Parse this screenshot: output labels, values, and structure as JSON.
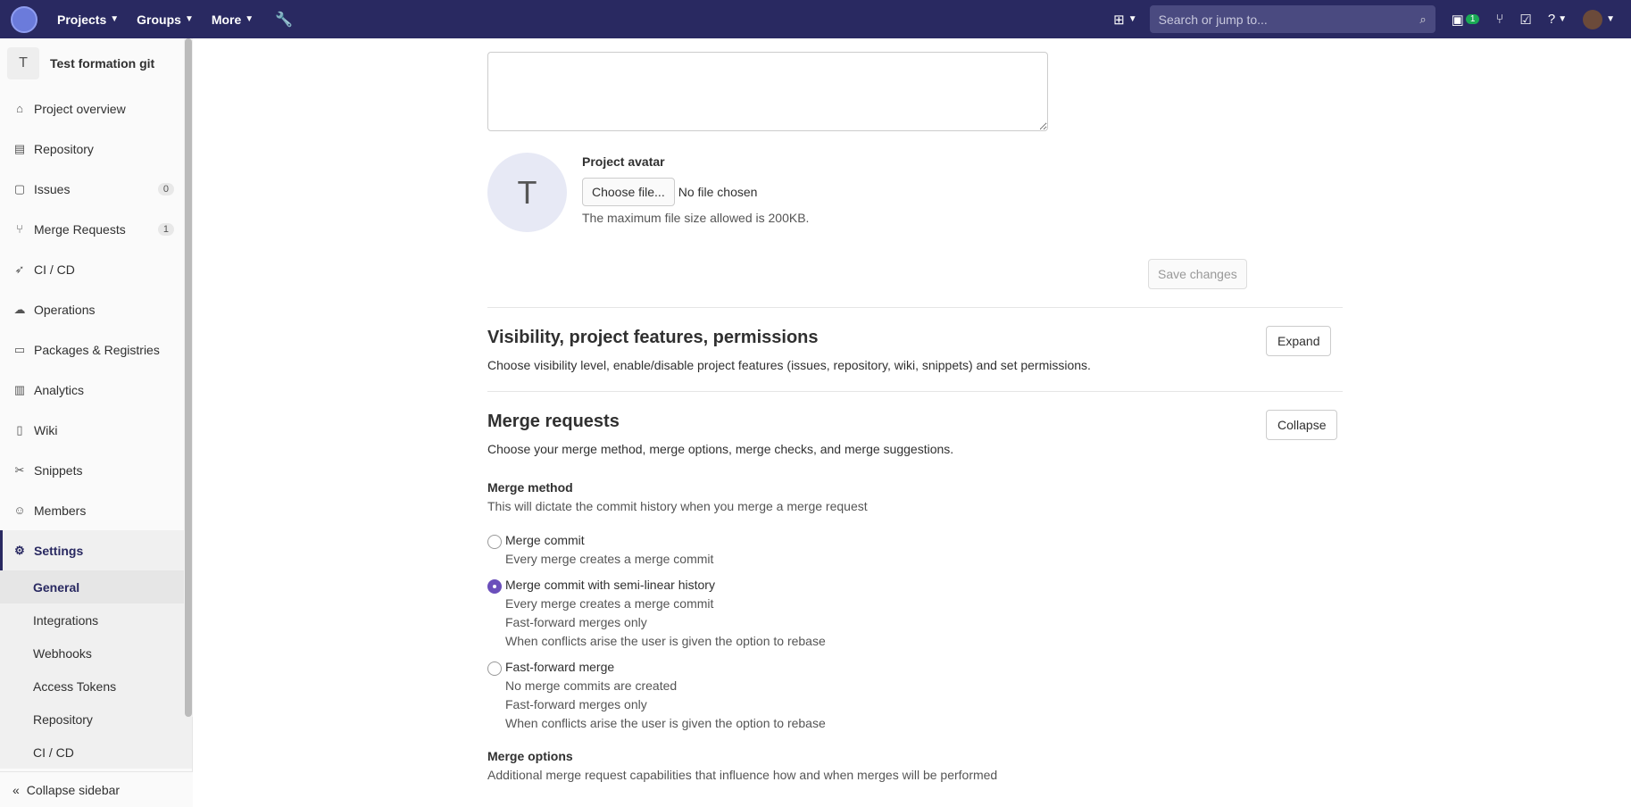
{
  "topbar": {
    "projects": "Projects",
    "groups": "Groups",
    "more": "More",
    "search_placeholder": "Search or jump to...",
    "mr_badge": "1"
  },
  "sidebar": {
    "project_initial": "T",
    "project_name": "Test formation git",
    "items": [
      {
        "label": "Project overview"
      },
      {
        "label": "Repository"
      },
      {
        "label": "Issues",
        "count": "0"
      },
      {
        "label": "Merge Requests",
        "count": "1"
      },
      {
        "label": "CI / CD"
      },
      {
        "label": "Operations"
      },
      {
        "label": "Packages & Registries"
      },
      {
        "label": "Analytics"
      },
      {
        "label": "Wiki"
      },
      {
        "label": "Snippets"
      },
      {
        "label": "Members"
      },
      {
        "label": "Settings"
      }
    ],
    "sub": [
      "General",
      "Integrations",
      "Webhooks",
      "Access Tokens",
      "Repository",
      "CI / CD"
    ],
    "collapse": "Collapse sidebar"
  },
  "main": {
    "avatar_initial": "T",
    "avatar_label": "Project avatar",
    "choose_file": "Choose file...",
    "no_file": "No file chosen",
    "max_size": "The maximum file size allowed is 200KB.",
    "save": "Save changes",
    "visibility": {
      "title": "Visibility, project features, permissions",
      "desc": "Choose visibility level, enable/disable project features (issues, repository, wiki, snippets) and set permissions.",
      "button": "Expand"
    },
    "mr": {
      "title": "Merge requests",
      "desc": "Choose your merge method, merge options, merge checks, and merge suggestions.",
      "button": "Collapse",
      "method_label": "Merge method",
      "method_help": "This will dictate the commit history when you merge a merge request",
      "options": [
        {
          "label": "Merge commit",
          "help": [
            "Every merge creates a merge commit"
          ]
        },
        {
          "label": "Merge commit with semi-linear history",
          "help": [
            "Every merge creates a merge commit",
            "Fast-forward merges only",
            "When conflicts arise the user is given the option to rebase"
          ]
        },
        {
          "label": "Fast-forward merge",
          "help": [
            "No merge commits are created",
            "Fast-forward merges only",
            "When conflicts arise the user is given the option to rebase"
          ]
        }
      ],
      "selected_option": 1,
      "options_label": "Merge options",
      "options_help": "Additional merge request capabilities that influence how and when merges will be performed"
    }
  }
}
